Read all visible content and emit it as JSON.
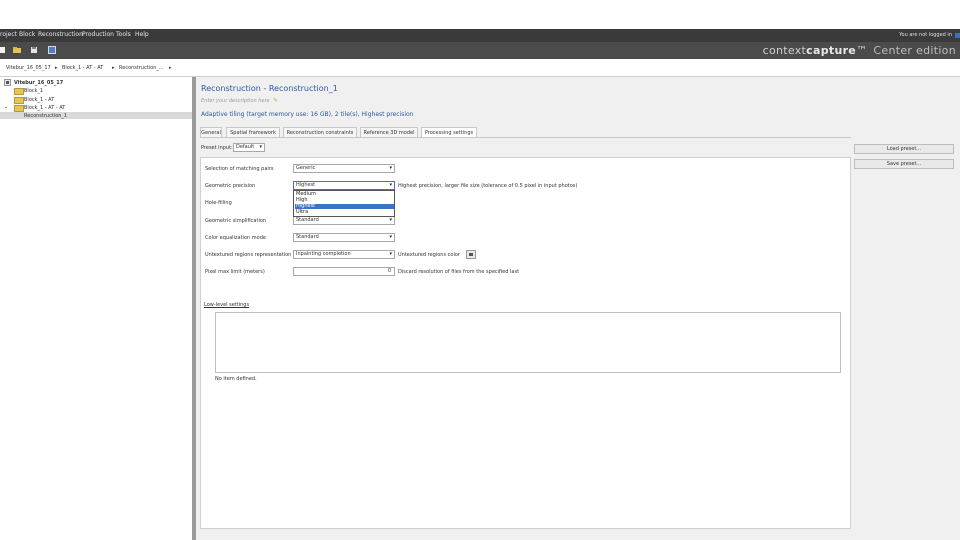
{
  "menu": {
    "items": [
      "roject",
      "Block",
      "Reconstruction",
      "Production",
      "Tools",
      "Help"
    ],
    "login_status": "You are not logged in"
  },
  "brand": {
    "prefix": "context",
    "bold": "capture",
    "tm": "™",
    "edition": "Center edition"
  },
  "breadcrumb": [
    "Vitebur_16_05_17",
    "Block_1 - AT - AT",
    "Reconstruction_..."
  ],
  "tree": {
    "root": "Vitebur_16_05_17",
    "items": [
      {
        "label": "Block_1"
      },
      {
        "label": "Block_1 - AT"
      },
      {
        "label": "Block_1 - AT - AT"
      }
    ],
    "selected": "Reconstruction_1"
  },
  "reconstruction": {
    "title": "Reconstruction - Reconstruction_1",
    "description_placeholder": "Enter your description here",
    "summary": "Adaptive tiling (target memory use: 16 GB), 2 tile(s), Highest precision"
  },
  "tabs": [
    "General",
    "Spatial framework",
    "Reconstruction constraints",
    "Reference 3D model",
    "Processing settings"
  ],
  "preset": {
    "label": "Preset input:",
    "value": "Default"
  },
  "settings": {
    "matching_pairs": {
      "label": "Selection of matching pairs",
      "value": "Generic"
    },
    "geometric_precision": {
      "label": "Geometric precision",
      "value": "Highest",
      "hint": "Highest precision, larger file size (tolerance of 0.5 pixel in input photos)",
      "options": [
        "Medium",
        "High",
        "Highest",
        "Ultra"
      ],
      "highlighted": "Highest"
    },
    "hole_filling": {
      "label": "Hole-filling"
    },
    "geometric_simplification": {
      "label": "Geometric simplification",
      "value": "Standard"
    },
    "color_equalization": {
      "label": "Color equalization mode",
      "value": "Standard"
    },
    "untextured": {
      "label": "Untextured regions representation",
      "value": "Inpainting completion",
      "color_label": "Untextured regions color"
    },
    "pixel_limit": {
      "label": "Pixel max limit (meters)",
      "value": "0",
      "hint": "Discard resolution of files from the specified last"
    }
  },
  "low_level": {
    "link": "Low-level settings",
    "empty": "No item defined."
  },
  "side_buttons": {
    "load": "Load preset...",
    "save": "Save preset..."
  },
  "colors": {
    "menubar_bg": "#3a3a3a",
    "toolbar_bg": "#4b4b4b",
    "accent_blue": "#2c57a0",
    "selection_blue": "#3b74c4",
    "folder": "#e5c55a"
  }
}
